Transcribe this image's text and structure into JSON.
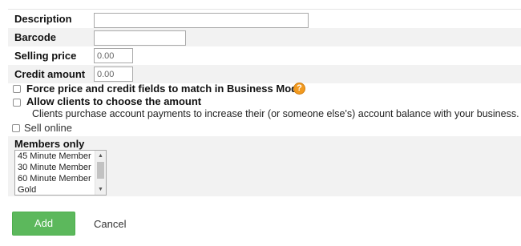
{
  "form": {
    "description_label": "Description",
    "barcode_label": "Barcode",
    "selling_price_label": "Selling price",
    "selling_price_value": "0.00",
    "credit_amount_label": "Credit amount",
    "credit_amount_value": "0.00",
    "force_match_label": "Force price and credit fields to match in Business Mode",
    "help_icon_glyph": "?",
    "allow_choose_label": "Allow clients to choose the amount",
    "allow_choose_description": "Clients purchase account payments to increase their (or someone else's) account balance with your business.",
    "sell_online_label": "Sell online",
    "members_only_label": "Members only",
    "members_options": [
      "45 Minute Member",
      "30 Minute Member",
      "60 Minute Member",
      "Gold"
    ],
    "scroll_up_glyph": "▲",
    "scroll_down_glyph": "▼"
  },
  "actions": {
    "add_label": "Add",
    "cancel_label": "Cancel"
  },
  "colors": {
    "add_button": "#5cb85c",
    "help_icon": "#f29a1f",
    "alt_row": "#f2f2f2"
  }
}
